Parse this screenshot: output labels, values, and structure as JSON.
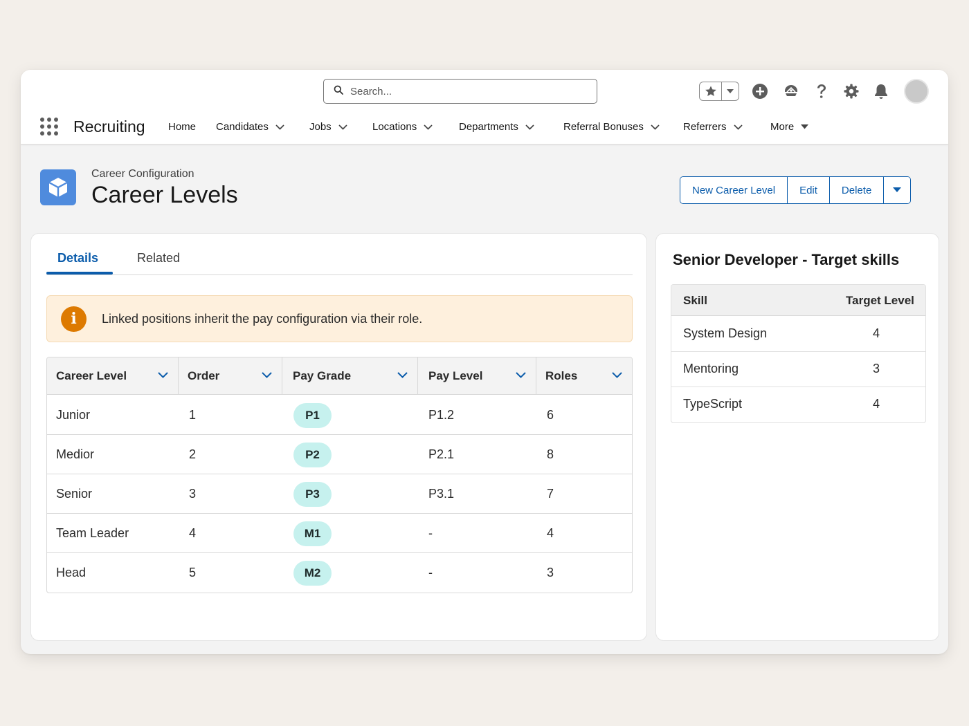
{
  "header": {
    "search": {
      "placeholder": "Search..."
    },
    "app_name": "Recruiting",
    "nav": [
      {
        "label": "Home",
        "has_dropdown": false
      },
      {
        "label": "Candidates",
        "has_dropdown": true
      },
      {
        "label": "Jobs",
        "has_dropdown": true
      },
      {
        "label": "Locations",
        "has_dropdown": true
      },
      {
        "label": "Departments",
        "has_dropdown": true
      },
      {
        "label": "Referral Bonuses",
        "has_dropdown": true
      },
      {
        "label": "Referrers",
        "has_dropdown": true
      },
      {
        "label": "More",
        "has_dropdown": true
      }
    ],
    "utility_icons": [
      "star-icon",
      "chevron-down-icon",
      "add-icon",
      "trailhead-icon",
      "help-icon",
      "gear-icon",
      "bell-icon",
      "avatar"
    ]
  },
  "page": {
    "breadcrumb": "Career Configuration",
    "title": "Career Levels",
    "object_icon": "cube-icon",
    "actions": {
      "new_label": "New Career Level",
      "edit_label": "Edit",
      "delete_label": "Delete"
    }
  },
  "main": {
    "tabs": [
      {
        "label": "Details",
        "active": true
      },
      {
        "label": "Related",
        "active": false
      }
    ],
    "alert": {
      "icon": "info-icon",
      "text": "Linked positions inherit the pay configuration via their role."
    },
    "table": {
      "columns": [
        "Career Level",
        "Order",
        "Pay Grade",
        "Pay Level",
        "Roles"
      ],
      "rows": [
        {
          "career_level": "Junior",
          "order": "1",
          "pay_grade": "P1",
          "pay_level": "P1.2",
          "roles": "6"
        },
        {
          "career_level": "Medior",
          "order": "2",
          "pay_grade": "P2",
          "pay_level": "P2.1",
          "roles": "8"
        },
        {
          "career_level": "Senior",
          "order": "3",
          "pay_grade": "P3",
          "pay_level": "P3.1",
          "roles": "7"
        },
        {
          "career_level": "Team Leader",
          "order": "4",
          "pay_grade": "M1",
          "pay_level": "-",
          "roles": "4"
        },
        {
          "career_level": "Head",
          "order": "5",
          "pay_grade": "M2",
          "pay_level": "-",
          "roles": "3"
        }
      ]
    }
  },
  "side": {
    "title": "Senior Developer - Target skills",
    "columns": [
      "Skill",
      "Target Level"
    ],
    "rows": [
      {
        "skill": "System Design",
        "target_level": "4"
      },
      {
        "skill": "Mentoring",
        "target_level": "3"
      },
      {
        "skill": "TypeScript",
        "target_level": "4"
      }
    ]
  },
  "colors": {
    "brand_blue": "#0b5cab",
    "object_icon_bg": "#4f8bdd",
    "alert_bg": "#fef0dd",
    "alert_icon": "#dd7a01",
    "pill_bg": "#c6f1ee",
    "page_bg": "#f3efea"
  }
}
